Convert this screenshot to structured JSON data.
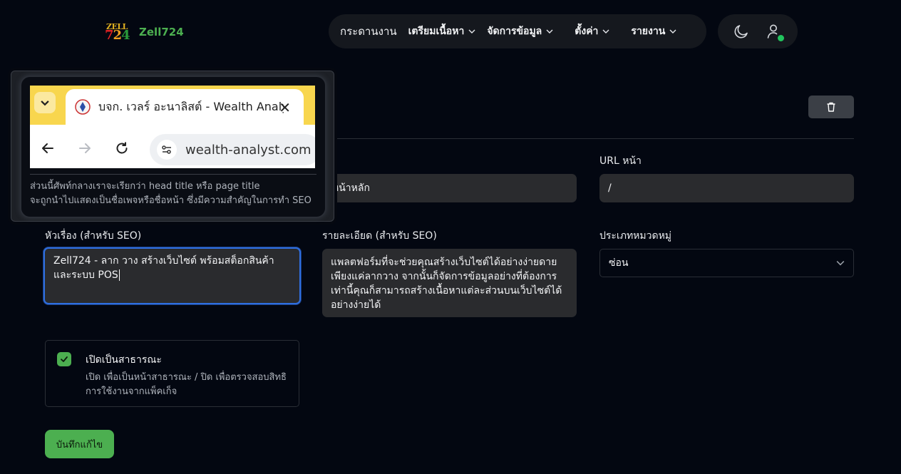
{
  "brand": {
    "logo_top": "ZELL",
    "logo_digits": [
      "7",
      "2",
      "4"
    ],
    "name": "Zell724"
  },
  "nav": {
    "items": [
      {
        "label": "กระดานงาน",
        "has_dropdown": false
      },
      {
        "label": "เตรียมเนื้อหา",
        "has_dropdown": true
      },
      {
        "label": "จัดการข้อมูล",
        "has_dropdown": true
      },
      {
        "label": "ตั้งค่า",
        "has_dropdown": true
      },
      {
        "label": "รายงาน",
        "has_dropdown": true
      }
    ]
  },
  "utility": {
    "theme_icon": "moon-icon",
    "user_icon": "user-icon",
    "status_color": "#22c55e"
  },
  "tooltip": {
    "tab_title": "บจก. เวลร์ อะนาลิสต์ - Wealth Analyst",
    "url": "wealth-analyst.com",
    "description_lines": [
      "ส่วนนี้ศัพท์กลางเราจะเรียกว่า head title หรือ page title",
      "จะถูกนำไปแสดงเป็นชื่อเพจหรือชื่อหน้า ซึ่งมีความสำคัญในการทำ SEO"
    ]
  },
  "form": {
    "page_name_value": "หน้าหลัก",
    "url_label": "URL หน้า",
    "url_value": "/",
    "seo_title_label": "หัวเรื่อง (สำหรับ SEO)",
    "seo_title_value": "Zell724 - ลาก วาง สร้างเว็บไซต์ พร้อมสต็อกสินค้าและระบบ POS",
    "seo_desc_label": "รายละเอียด (สำหรับ SEO)",
    "seo_desc_value": "แพลตฟอร์มที่จะช่วยคุณสร้างเว็บไซต์ได้อย่างง่ายดาย เพียงแค่ลากวาง จากนั้นก็จัดการข้อมูลอย่างที่ต้องการ เท่านี้คุณก็สามารถสร้างเนื้อหาแต่ละส่วนบนเว็บไซต์ได้อย่างง่ายได้",
    "category_label": "ประเภทหมวดหมู่",
    "category_value": "ซ่อน",
    "public_title": "เปิดเป็นสาธารณะ",
    "public_desc": "เปิด เพื่อเป็นหน้าสาธารณะ / ปิด เพื่อตรวจสอบสิทธิการใช้งานจากแพ็คเก็จ",
    "public_checked": true,
    "save_label": "บันทึกแก้ไข"
  },
  "colors": {
    "accent": "#4caf50",
    "background": "#030711",
    "focus": "#2f6fe0"
  }
}
